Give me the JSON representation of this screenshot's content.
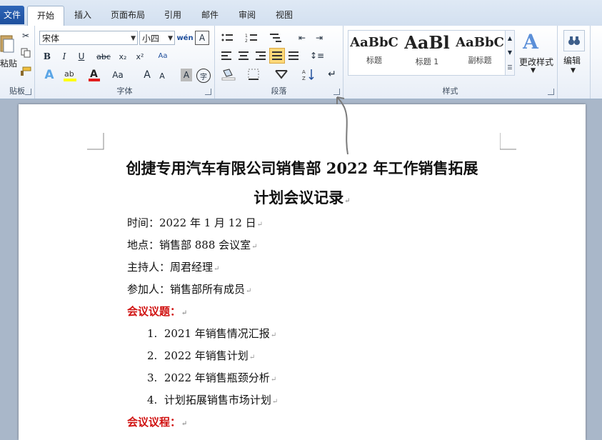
{
  "tabs": [
    "文件",
    "开始",
    "插入",
    "页面布局",
    "引用",
    "邮件",
    "审阅",
    "视图"
  ],
  "font": {
    "name": "宋体",
    "size": "小四",
    "group_label": "字体"
  },
  "clipboard": {
    "paste_label": "粘贴",
    "group_label": "贴板"
  },
  "paragraph": {
    "group_label": "段落"
  },
  "styles": {
    "group_label": "样式",
    "items": [
      {
        "sample": "AaBbC",
        "name": "标题"
      },
      {
        "sample": "AaBl",
        "name": "标题 1"
      },
      {
        "sample": "AaBbC",
        "name": "副标题"
      }
    ],
    "change_label": "更改样式"
  },
  "editing": {
    "label": "编辑"
  },
  "document": {
    "title_line1": "创捷专用汽车有限公司销售部 2022 年工作销售拓展",
    "title_line2": "计划会议记录",
    "lines": [
      "时间：2022 年 1 月 12 日",
      "地点：销售部 888 会议室",
      "主持人：周君经理",
      "参加人：销售部所有成员"
    ],
    "agenda_heading": "会议议题：",
    "agenda": [
      {
        "num": "1.",
        "text": "2021 年销售情况汇报"
      },
      {
        "num": "2.",
        "text": "2022 年销售计划"
      },
      {
        "num": "3.",
        "text": "2022 年销售瓶颈分析"
      },
      {
        "num": "4.",
        "text": "计划拓展销售市场计划"
      }
    ],
    "process_heading": "会议议程：",
    "para_mark": "↵"
  }
}
